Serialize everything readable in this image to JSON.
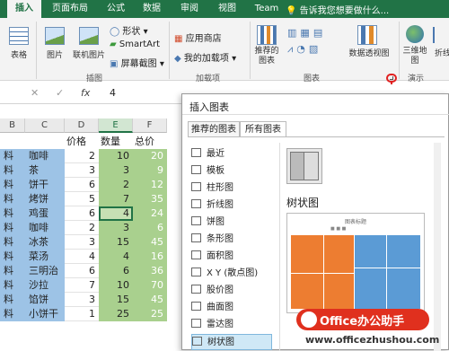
{
  "tabs": [
    "插入",
    "页面布局",
    "公式",
    "数据",
    "审阅",
    "视图",
    "Team"
  ],
  "tell_me": "告诉我您想要做什么...",
  "ribbon": {
    "table": "表格",
    "pictures": "图片",
    "online_pictures": "联机图片",
    "shapes": "形状",
    "smartart": "SmartArt",
    "screenshot": "屏幕截图",
    "app_store": "应用商店",
    "my_addins": "我的加载项",
    "recommended_charts": "推荐的图表",
    "pivot_chart": "数据透视图",
    "map_3d": "三维地图",
    "line_spark": "折线",
    "groups": {
      "illustrations": "插图",
      "addins": "加载项",
      "charts": "图表",
      "tours": "演示"
    }
  },
  "formula_bar": {
    "value": "4",
    "fx": "fx"
  },
  "sheet": {
    "columns": [
      "B",
      "C",
      "D",
      "E",
      "F"
    ],
    "headers": [
      "价格",
      "数量",
      "总价"
    ],
    "rows": [
      {
        "b": "料",
        "c": "咖啡",
        "d": "2",
        "e": "10",
        "f": "20"
      },
      {
        "b": "料",
        "c": "茶",
        "d": "3",
        "e": "3",
        "f": "9"
      },
      {
        "b": "料",
        "c": "饼干",
        "d": "6",
        "e": "2",
        "f": "12"
      },
      {
        "b": "料",
        "c": "烤饼",
        "d": "5",
        "e": "7",
        "f": "35"
      },
      {
        "b": "料",
        "c": "鸡蛋",
        "d": "6",
        "e": "4",
        "f": "24"
      },
      {
        "b": "料",
        "c": "咖啡",
        "d": "2",
        "e": "3",
        "f": "6"
      },
      {
        "b": "料",
        "c": "冰茶",
        "d": "3",
        "e": "15",
        "f": "45"
      },
      {
        "b": "料",
        "c": "菜汤",
        "d": "4",
        "e": "4",
        "f": "16"
      },
      {
        "b": "料",
        "c": "三明治",
        "d": "6",
        "e": "6",
        "f": "36"
      },
      {
        "b": "料",
        "c": "沙拉",
        "d": "7",
        "e": "10",
        "f": "70"
      },
      {
        "b": "料",
        "c": "馅饼",
        "d": "3",
        "e": "15",
        "f": "45"
      },
      {
        "b": "料",
        "c": "小饼干",
        "d": "1",
        "e": "25",
        "f": "25"
      }
    ]
  },
  "dialog": {
    "title": "插入图表",
    "tabs": [
      "推荐的图表",
      "所有图表"
    ],
    "categories": [
      "最近",
      "模板",
      "柱形图",
      "折线图",
      "饼图",
      "条形图",
      "面积图",
      "X Y (散点图)",
      "股价图",
      "曲面图",
      "雷达图",
      "树状图"
    ],
    "selected": "树状图",
    "chart_type_title": "树状图",
    "preview_title": "图表标题"
  },
  "watermark": {
    "brand": "Office办公助手",
    "url": "www.officezhushou.com"
  },
  "colors": {
    "excel_green": "#217346",
    "treemap_orange": "#ed7d31",
    "treemap_blue": "#5b9bd5",
    "highlight_red": "#e02020"
  }
}
